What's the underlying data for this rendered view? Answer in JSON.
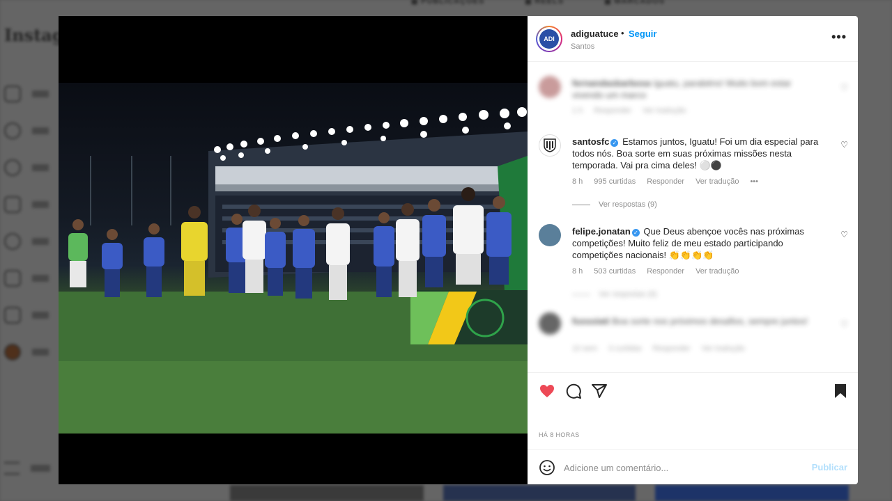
{
  "background": {
    "tabs": [
      "PUBLICAÇÕES",
      "REELS",
      "MARCADOS"
    ],
    "logo": "Instagram"
  },
  "post": {
    "account": {
      "username": "adiguatuce",
      "avatar_initials": "ADI",
      "separator": "•",
      "follow_label": "Seguir",
      "location": "Santos"
    },
    "more_icon": "more-horizontal-icon",
    "comments": [
      {
        "username": "fernandasbarbosa",
        "text": "Iguatu, parabéns! Muito bom estar vivendo um marco",
        "time": "1 h",
        "reply_label": "Responder",
        "translate_label": "Ver tradução",
        "blurred": true
      },
      {
        "username": "santosfc",
        "verified": true,
        "text": "Estamos juntos, Iguatu! Foi um dia especial para todos nós. Boa sorte em suas próximas missões nesta temporada. Vai pra cima deles! ⚪⚫",
        "time": "8 h",
        "likes": "995 curtidas",
        "reply_label": "Responder",
        "translate_label": "Ver tradução",
        "options": "•••",
        "view_replies": "Ver respostas (9)"
      },
      {
        "username": "felipe.jonatan",
        "verified": true,
        "text": "Que Deus abençoe vocês nas próximas competições! Muito feliz de meu estado participando competições nacionais! 👏👏👏👏",
        "time": "8 h",
        "likes": "503 curtidas",
        "reply_label": "Responder",
        "translate_label": "Ver tradução",
        "view_replies": "Ver respostas (6)"
      },
      {
        "username": "fussoiati",
        "text": "Boa sorte nos próximos desafios, sempre juntos!",
        "time": "10 sem",
        "likes": "3 curtidas",
        "reply_label": "Responder",
        "translate_label": "Ver tradução",
        "blurred": true
      }
    ],
    "actions": {
      "liked": true,
      "saved": true,
      "like_color": "#ed4956"
    },
    "timestamp": "HÁ 8 HORAS",
    "comment_input": {
      "placeholder": "Adicione um comentário...",
      "publish_label": "Publicar"
    }
  }
}
